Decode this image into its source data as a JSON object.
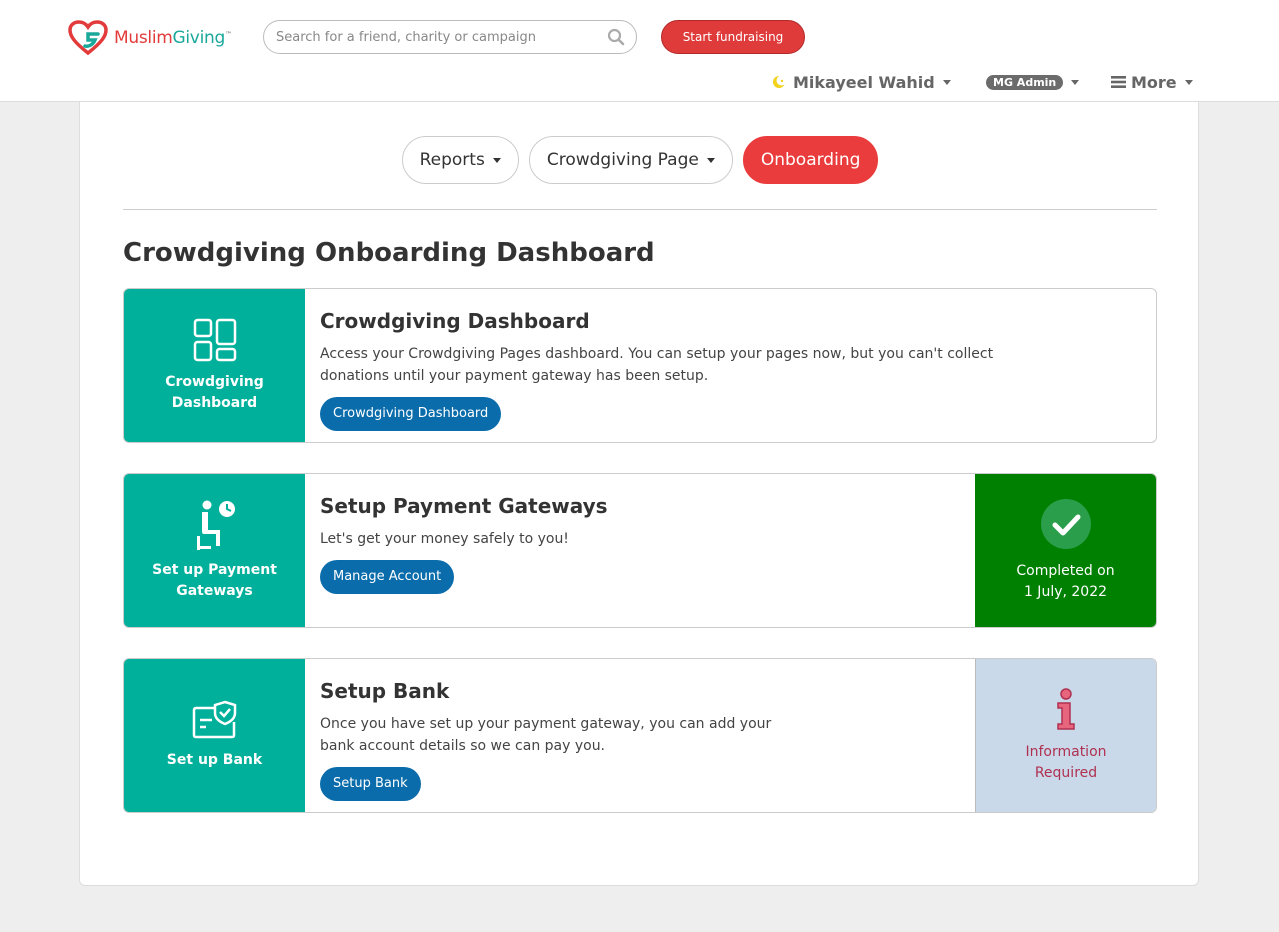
{
  "colors": {
    "brand_red": "#e03b3b",
    "brand_teal": "#00b09a",
    "button_blue": "#0a6cab",
    "complete_green": "#008000",
    "info_blue_bg": "#c9d9ea"
  },
  "header": {
    "logo_primary": "Muslim",
    "logo_secondary": "Giving",
    "logo_tm": "™",
    "search_placeholder": "Search for a friend, charity or campaign",
    "start_label": "Start fundraising",
    "user_name": "Mikayeel Wahid",
    "admin_label": "MG Admin",
    "more_label": "More"
  },
  "tabs": [
    {
      "label": "Reports"
    },
    {
      "label": "Crowdgiving Page"
    },
    {
      "label": "Onboarding"
    }
  ],
  "page": {
    "title": "Crowdgiving Onboarding Dashboard"
  },
  "steps": [
    {
      "tile_label": "Crowdgiving Dashboard",
      "title": "Crowdgiving Dashboard",
      "desc_line1": "Access your Crowdgiving Pages dashboard. You can setup your pages now, but you can't collect",
      "desc_line2": "donations until your payment gateway has been setup.",
      "button": "Crowdgiving Dashboard",
      "icon": "dashboard-icon"
    },
    {
      "tile_label": "Set up Payment Gateways",
      "title": "Setup Payment Gateways",
      "desc_line1": "Let's get your money safely to you!",
      "button": "Manage Account",
      "icon": "person-clock-icon",
      "status_line1": "Completed on",
      "status_line2": "1 July, 2022",
      "status_icon": "check-circle-icon"
    },
    {
      "tile_label": "Set up Bank",
      "title": "Setup Bank",
      "desc_line1": "Once you have set up your payment gateway, you can add your",
      "desc_line2": "bank account details so we can pay you.",
      "button": "Setup Bank",
      "icon": "bank-card-shield-icon",
      "status_line1": "Information",
      "status_line2": "Required",
      "status_icon": "info-icon"
    }
  ]
}
